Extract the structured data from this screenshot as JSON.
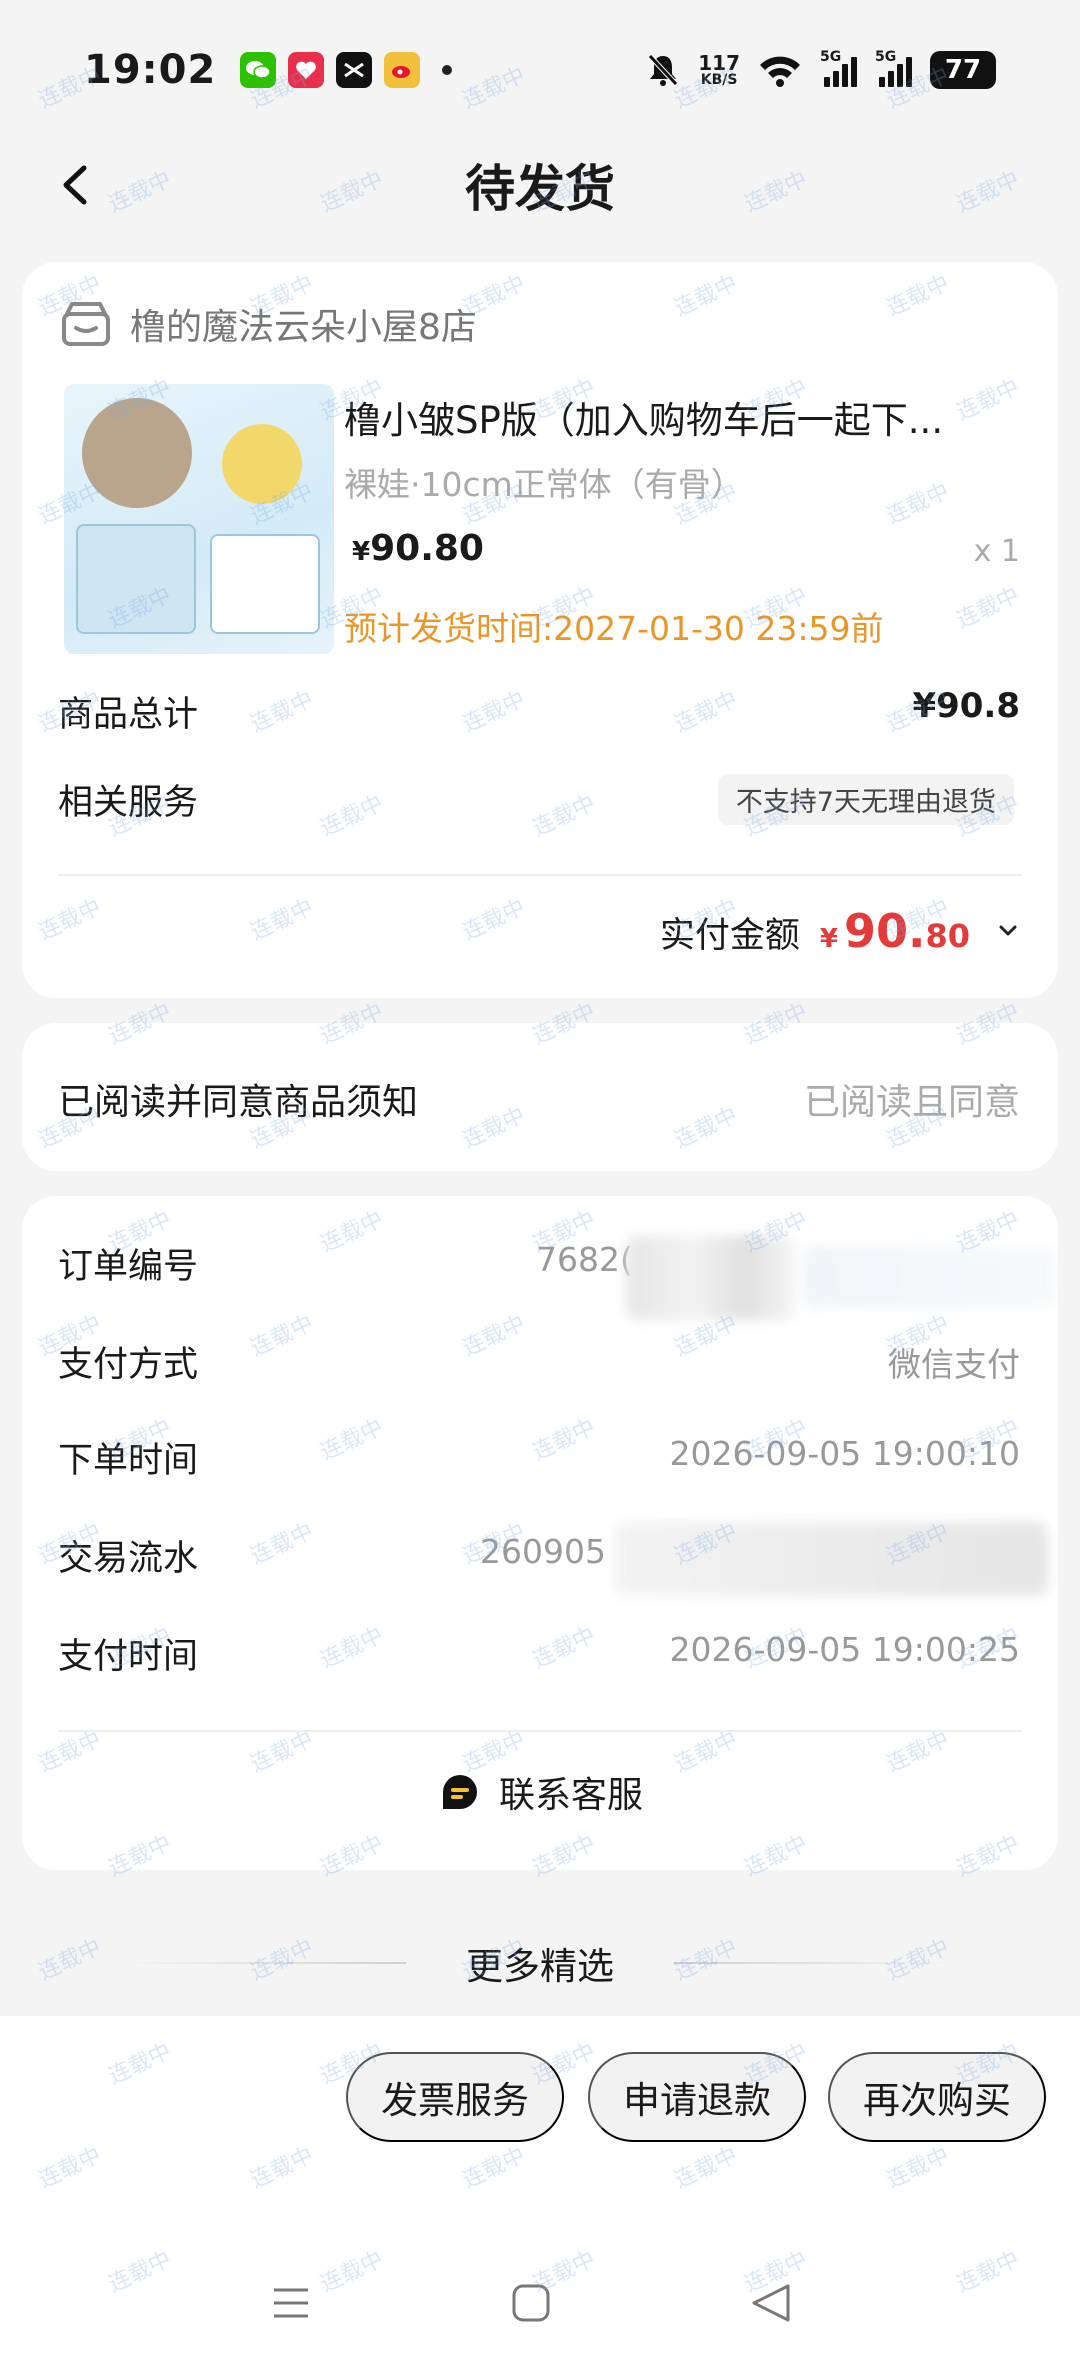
{
  "status_bar": {
    "time": "19:02",
    "net_speed_value": "117",
    "net_speed_unit": "KB/S",
    "sim1_label": "5G",
    "sim2_label": "5G",
    "battery": "77",
    "icons": [
      "wechat-icon",
      "red-app-icon",
      "capcut-icon",
      "weibo-icon",
      "mute-icon",
      "wifi-icon",
      "signal-icon",
      "battery-icon"
    ]
  },
  "nav": {
    "title": "待发货",
    "back_icon": "back-arrow-icon"
  },
  "order_card": {
    "shop_name": "橹的魔法云朵小屋8店",
    "product": {
      "title": "橹小皱SP版（加入购物车后一起下...",
      "spec": "裸娃·10cm正常体（有骨）",
      "price_symbol": "¥",
      "price": "90.80",
      "quantity": "x 1",
      "ship_time": "预计发货时间:2027-01-30 23:59前"
    },
    "total_label": "商品总计",
    "total_value": "¥90.8",
    "service_label": "相关服务",
    "service_tag": "不支持7天无理由退货",
    "paid_label": "实付金额",
    "paid_symbol": "¥",
    "paid_int": "90.",
    "paid_dec": "80"
  },
  "agreement": {
    "label": "已阅读并同意商品须知",
    "status": "已阅读且同意"
  },
  "order_info": {
    "rows": [
      {
        "label": "订单编号",
        "value": "7682("
      },
      {
        "label": "支付方式",
        "value": "微信支付"
      },
      {
        "label": "下单时间",
        "value": "2026-09-05 19:00:10"
      },
      {
        "label": "交易流水",
        "value": "260905"
      },
      {
        "label": "支付时间",
        "value": "2026-09-05 19:00:25"
      }
    ],
    "contact_label": "联系客服"
  },
  "more": {
    "label": "更多精选"
  },
  "actions": {
    "invoice": "发票服务",
    "refund": "申请退款",
    "rebuy": "再次购买"
  },
  "watermark": "连载中",
  "colors": {
    "accent_orange": "#e8962a",
    "price_red": "#e33a3a"
  }
}
